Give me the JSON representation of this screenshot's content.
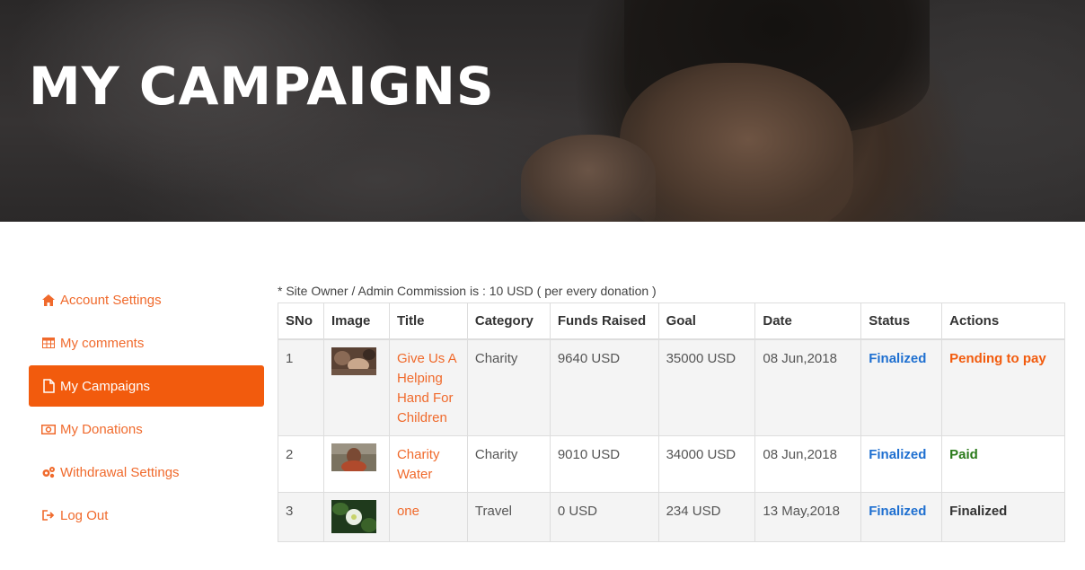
{
  "hero": {
    "title": "MY CAMPAIGNS"
  },
  "sidebar": {
    "items": [
      {
        "label": "Account Settings",
        "icon": "home-icon",
        "active": false
      },
      {
        "label": "My comments",
        "icon": "table-icon",
        "active": false
      },
      {
        "label": "My Campaigns",
        "icon": "file-icon",
        "active": true
      },
      {
        "label": "My Donations",
        "icon": "money-icon",
        "active": false
      },
      {
        "label": "Withdrawal Settings",
        "icon": "cogs-icon",
        "active": false
      },
      {
        "label": "Log Out",
        "icon": "sign-out-icon",
        "active": false
      }
    ]
  },
  "note": "* Site Owner / Admin Commission is : 10 USD ( per every donation )",
  "table": {
    "headers": [
      "SNo",
      "Image",
      "Title",
      "Category",
      "Funds Raised",
      "Goal",
      "Date",
      "Status",
      "Actions"
    ],
    "rows": [
      {
        "sno": "1",
        "title": "Give Us A Helping Hand For Children",
        "category": "Charity",
        "funds": "9640 USD",
        "goal": "35000 USD",
        "date": "08 Jun,2018",
        "status": "Finalized",
        "action": "Pending to pay"
      },
      {
        "sno": "2",
        "title": "Charity Water",
        "category": "Charity",
        "funds": "9010 USD",
        "goal": "34000 USD",
        "date": "08 Jun,2018",
        "status": "Finalized",
        "action": "Paid"
      },
      {
        "sno": "3",
        "title": "one",
        "category": "Travel",
        "funds": "0 USD",
        "goal": "234 USD",
        "date": "13 May,2018",
        "status": "Finalized",
        "action": "Finalized"
      }
    ]
  },
  "colors": {
    "accent": "#f25b0d",
    "link": "#f06a2c",
    "status": "#1e6fd0",
    "paid": "#2a7a1a"
  }
}
